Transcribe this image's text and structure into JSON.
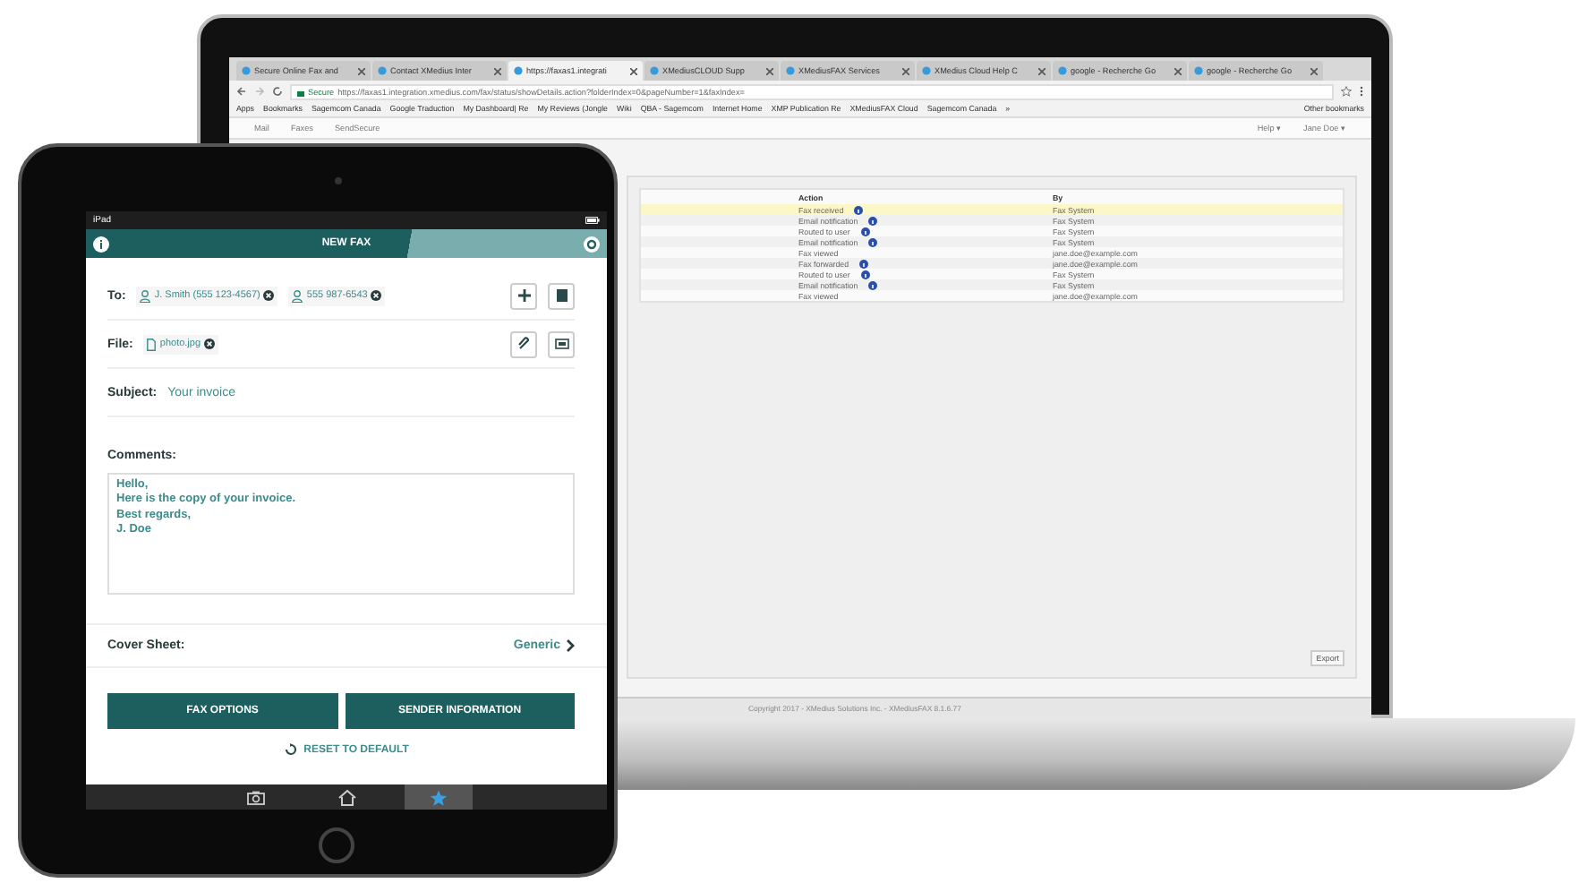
{
  "browser": {
    "tabs": [
      {
        "label": "Secure Online Fax and",
        "selected": false
      },
      {
        "label": "Contact XMedius Inter",
        "selected": false
      },
      {
        "label": "https://faxas1.integrati",
        "selected": true
      },
      {
        "label": "XMediusCLOUD Supp",
        "selected": false
      },
      {
        "label": "XMediusFAX Services",
        "selected": false
      },
      {
        "label": "XMedius Cloud Help C",
        "selected": false
      },
      {
        "label": "google - Recherche Go",
        "selected": false
      },
      {
        "label": "google - Recherche Go",
        "selected": false
      }
    ],
    "address": {
      "secure_label": "Secure",
      "url": "https://faxas1.integration.xmedius.com/fax/status/showDetails.action?folderIndex=0&pageNumber=1&faxIndex="
    },
    "bookmarks": [
      "Apps",
      "Bookmarks",
      "Sagemcom Canada",
      "Google Traduction",
      "My Dashboard| Re",
      "My Reviews (Jongle",
      "Wiki",
      "QBA - Sagemcom",
      "Internet Home",
      "XMP Publication Re",
      "XMediusFAX Cloud",
      "Sagemcom Canada",
      "»",
      "Other bookmarks"
    ],
    "app": {
      "nav": [
        "Mail",
        "Faxes",
        "SendSecure"
      ],
      "menus": [
        "Help ▾",
        "Jane Doe ▾"
      ],
      "table": {
        "columns": [
          "Action",
          "By"
        ],
        "rows": [
          {
            "action": "Fax received",
            "by": "Fax System",
            "info": true,
            "selected": true
          },
          {
            "action": "Email notification",
            "by": "Fax System",
            "info": true,
            "selected": false
          },
          {
            "action": "Routed to user",
            "by": "Fax System",
            "info": true,
            "selected": false
          },
          {
            "action": "Email notification",
            "by": "Fax System",
            "info": true,
            "selected": false
          },
          {
            "action": "Fax viewed",
            "by": "jane.doe@example.com",
            "info": false,
            "selected": false
          },
          {
            "action": "Fax forwarded",
            "by": "jane.doe@example.com",
            "info": true,
            "selected": false
          },
          {
            "action": "Routed to user",
            "by": "Fax System",
            "info": true,
            "selected": false
          },
          {
            "action": "Email notification",
            "by": "Fax System",
            "info": true,
            "selected": false
          },
          {
            "action": "Fax viewed",
            "by": "jane.doe@example.com",
            "info": false,
            "selected": false
          }
        ]
      },
      "export_button": "Export",
      "footer": "Copyright 2017 - XMedius Solutions Inc. - XMediusFAX 8.1.6.77"
    }
  },
  "tablet": {
    "status": {
      "carrier": "iPad"
    },
    "title": "NEW FAX",
    "to": {
      "label": "To:",
      "recipients": [
        "J. Smith (555 123-4567)",
        "555 987-6543"
      ]
    },
    "file": {
      "label": "File:",
      "attachments": [
        "photo.jpg"
      ]
    },
    "subject": {
      "label": "Subject:",
      "value": "Your invoice"
    },
    "comments": {
      "label": "Comments:",
      "value": "Hello,\nHere is the copy of your invoice.\nBest regards,\nJ. Doe"
    },
    "cover_sheet": {
      "label": "Cover Sheet:",
      "value": "Generic"
    },
    "buttons": [
      "FAX OPTIONS",
      "SENDER INFORMATION"
    ],
    "reset_link": "RESET TO DEFAULT",
    "tab_bar": [
      {
        "kind": "camera",
        "selected": false
      },
      {
        "kind": "home",
        "selected": false
      },
      {
        "kind": "star",
        "selected": true
      }
    ]
  }
}
